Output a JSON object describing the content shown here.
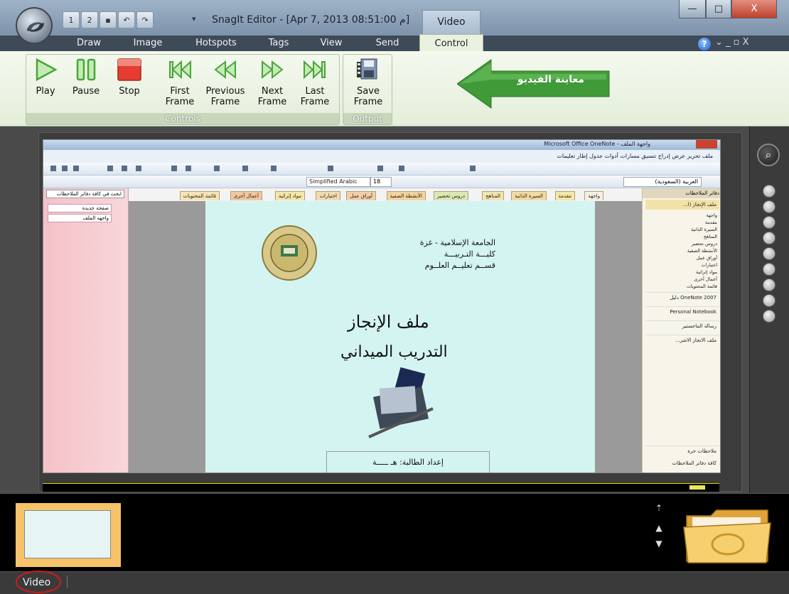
{
  "app": {
    "title": "SnagIt Editor - [Apr 7, 2013 08:51:00 م]",
    "context_tab": "Video"
  },
  "quick_access": [
    "1",
    "2",
    "save",
    "undo",
    "redo"
  ],
  "window_controls": {
    "minimize": "—",
    "maximize": "□",
    "close": "X"
  },
  "ribbon_tabs": [
    {
      "label": "Draw"
    },
    {
      "label": "Image"
    },
    {
      "label": "Hotspots"
    },
    {
      "label": "Tags"
    },
    {
      "label": "View"
    },
    {
      "label": "Send"
    },
    {
      "label": "Control",
      "active": true
    }
  ],
  "ribbon_right": {
    "help": "?",
    "menu": "⌄ _ ▫ X"
  },
  "groups": {
    "controls": {
      "label": "Controls",
      "buttons": [
        {
          "label": "Play",
          "icon": "play-icon"
        },
        {
          "label": "Pause",
          "icon": "pause-icon"
        },
        {
          "label": "Stop",
          "icon": "stop-icon"
        },
        {
          "label": "First Frame",
          "icon": "first-frame-icon"
        },
        {
          "label": "Previous Frame",
          "icon": "previous-frame-icon"
        },
        {
          "label": "Next Frame",
          "icon": "next-frame-icon"
        },
        {
          "label": "Last Frame",
          "icon": "last-frame-icon"
        }
      ]
    },
    "output": {
      "label": "Output",
      "buttons": [
        {
          "label": "Save Frame",
          "icon": "save-frame-icon"
        }
      ]
    }
  },
  "annotation": {
    "text": "معاينة الفيديو",
    "color": "#4fa043"
  },
  "captured": {
    "window_title": "Microsoft Office OneNote - واجهة الملف",
    "menu": "ملف  تحرير  عرض  إدراج  تنسيق  مسارات  أدوات  جدول  إطار  تعليمات",
    "font": "Simplified Arabic",
    "size": "18",
    "style": "العربية (السعودية)",
    "left_pane": {
      "search": "ابحث في كافة دفاتر الملاحظات",
      "items": [
        "صفحة جديدة",
        "واجهه الملف"
      ]
    },
    "section_tabs": [
      "واجهة",
      "مقدمة",
      "السيرة الذاتية",
      "المناهج",
      "دروس تحضير",
      "الأنشطة الصفية",
      "أوراق عمل",
      "اختبارات",
      "مواد إثرائية",
      "أعمال أخرى",
      "قائمة المحتويات"
    ],
    "page": {
      "line1": "الجامعة الإسلامية - غزة",
      "line2": "كليـــة التـربيـــة",
      "line3": "قســم تعليــم العلــوم",
      "title1": "ملف الإنجاز",
      "title2": "التدريب الميداني",
      "footer": "إعداد الطالبة: هـ ـــــة"
    },
    "right_pane": {
      "header": "دفاتر الملاحظات",
      "notebook": "ملف الإنجاز (ا...",
      "sections": [
        "واجهة",
        "مقدمة",
        "السيرة الذاتية",
        "المناهج",
        "دروس تحضير",
        "الأنشطة الصفية",
        "أوراق عمل",
        "اختبارات",
        "مواد إثرائية",
        "أعمال أخرى",
        "قائمة المحتويات"
      ],
      "other_notebooks": [
        "OneNote 2007 دليل",
        "Personal Notebook",
        "رسالة الماجستير",
        "ملف الانجاز الاشر..."
      ],
      "bottom": [
        "ملاحظات حرة",
        "كافة دفاتر الملاحظات"
      ]
    }
  },
  "statusbar": {
    "label": "Video"
  }
}
